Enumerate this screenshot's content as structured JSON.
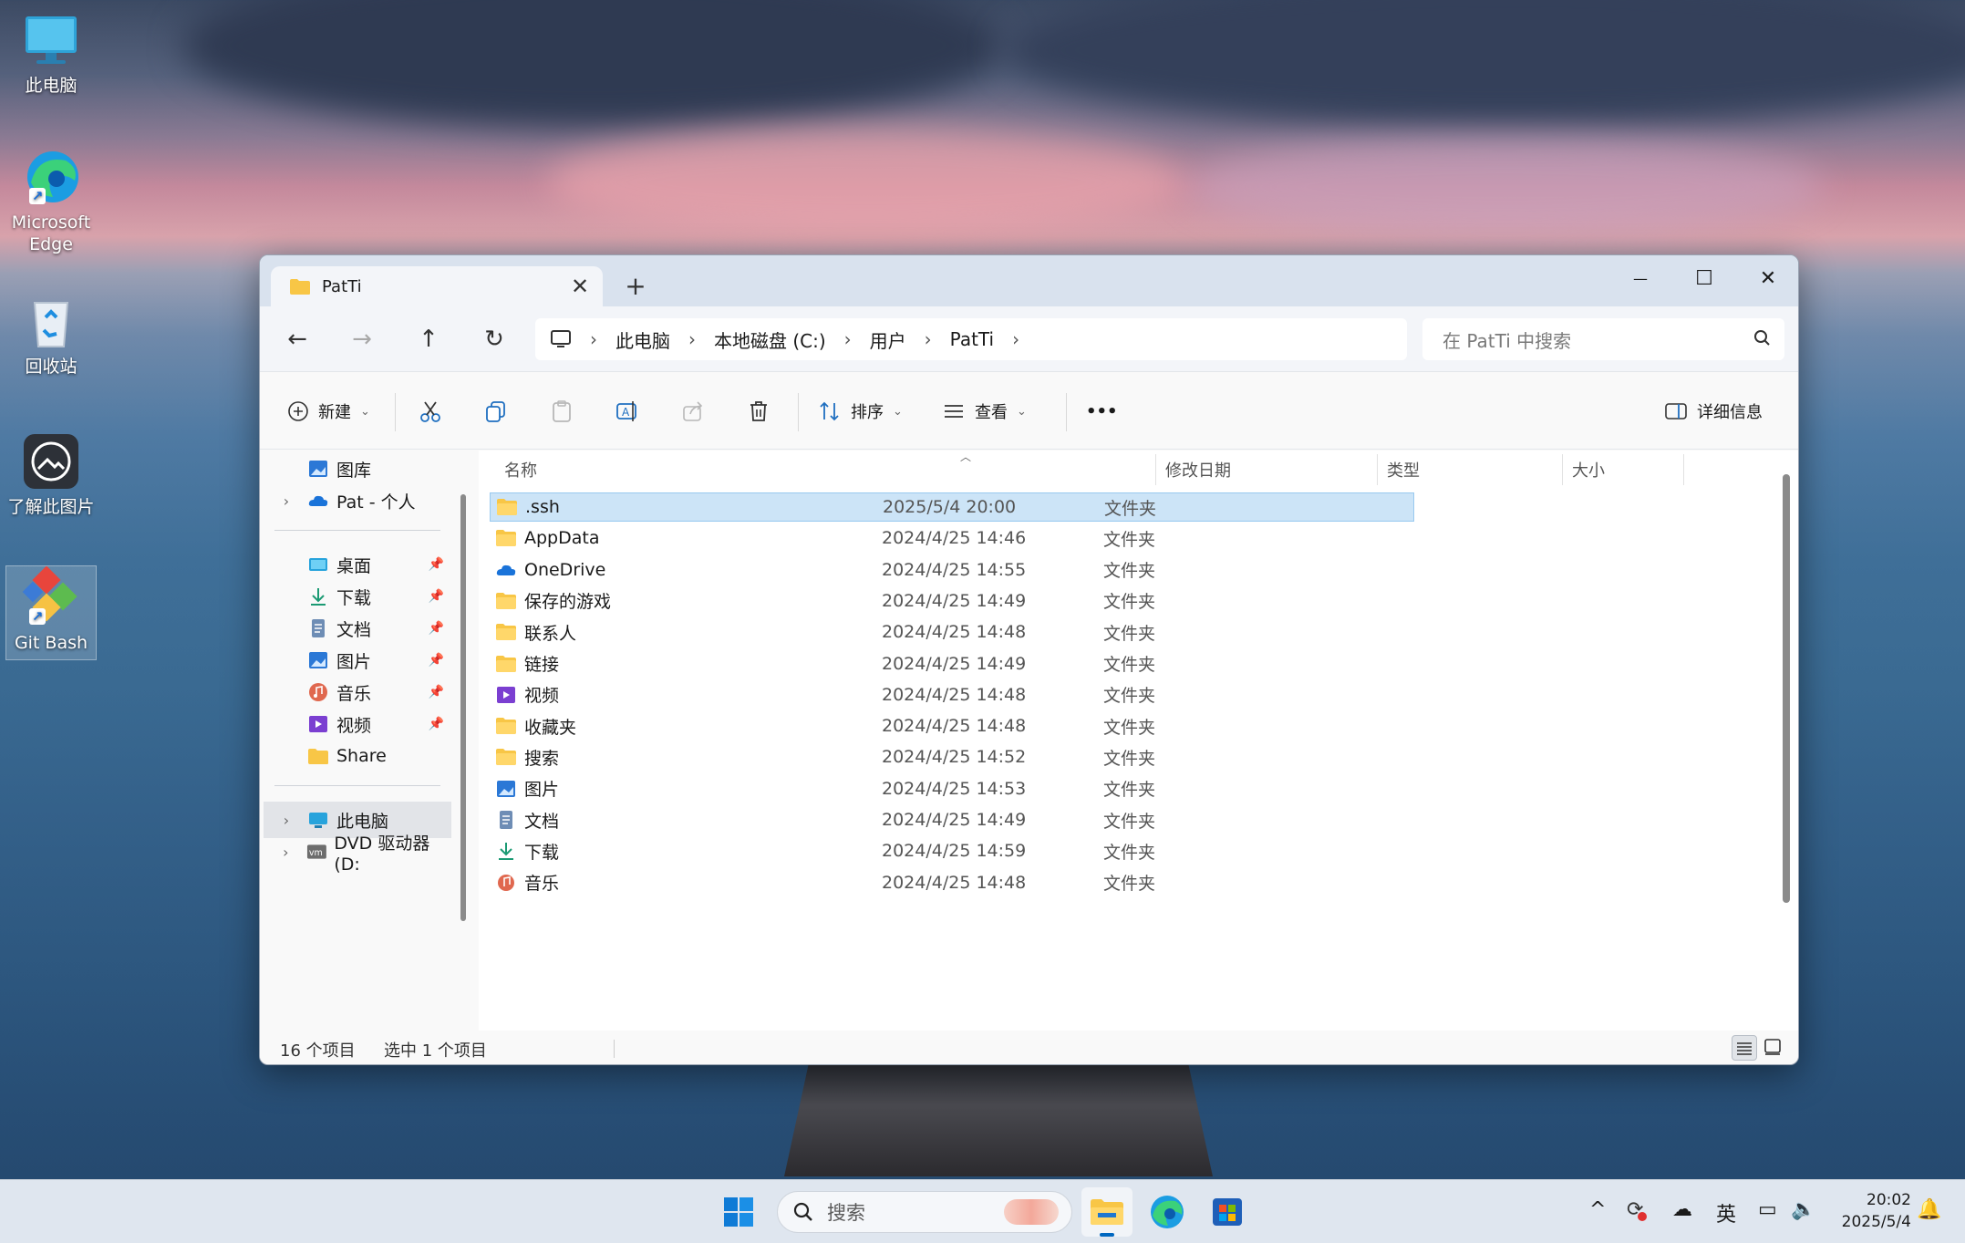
{
  "desktop": {
    "icons": [
      {
        "label": "此电脑"
      },
      {
        "label": "Microsoft Edge"
      },
      {
        "label": "回收站"
      },
      {
        "label": "了解此图片"
      },
      {
        "label": "Git Bash"
      }
    ]
  },
  "window": {
    "tab_title": "PatTi",
    "tab_close": "✕",
    "new_tab": "+",
    "controls": {
      "minimize": "—",
      "maximize": "☐",
      "close": "✕"
    }
  },
  "address": {
    "back": "←",
    "forward": "→",
    "up": "↑",
    "refresh": "↻",
    "crumbs": [
      "此电脑",
      "本地磁盘 (C:)",
      "用户",
      "PatTi"
    ],
    "separator": "›",
    "search_placeholder": "在 PatTi 中搜索"
  },
  "toolbar": {
    "new_label": "新建",
    "sort_label": "排序",
    "view_label": "查看",
    "more_label": "•••",
    "details_label": "详细信息"
  },
  "sidebar": {
    "items": [
      {
        "label": "图库",
        "icon": "gallery-icon"
      },
      {
        "label": "Pat - 个人",
        "icon": "onedrive-icon"
      },
      {
        "label": "桌面",
        "icon": "desktop-icon"
      },
      {
        "label": "下载",
        "icon": "download-icon"
      },
      {
        "label": "文档",
        "icon": "document-icon"
      },
      {
        "label": "图片",
        "icon": "pictures-icon"
      },
      {
        "label": "音乐",
        "icon": "music-icon"
      },
      {
        "label": "视频",
        "icon": "videos-icon"
      },
      {
        "label": "Share",
        "icon": "folder-icon"
      },
      {
        "label": "此电脑",
        "icon": "this-pc-icon"
      },
      {
        "label": "DVD 驱动器 (D:",
        "icon": "dvd-icon"
      }
    ],
    "pin": "📌",
    "expand": "›"
  },
  "columns": {
    "name": "名称",
    "date": "修改日期",
    "type": "类型",
    "size": "大小"
  },
  "files": [
    {
      "name": ".ssh",
      "date": "2025/5/4 20:00",
      "type": "文件夹",
      "icon": "folder-icon"
    },
    {
      "name": "AppData",
      "date": "2024/4/25 14:46",
      "type": "文件夹",
      "icon": "folder-icon"
    },
    {
      "name": "OneDrive",
      "date": "2024/4/25 14:55",
      "type": "文件夹",
      "icon": "onedrive-icon"
    },
    {
      "name": "保存的游戏",
      "date": "2024/4/25 14:49",
      "type": "文件夹",
      "icon": "folder-icon"
    },
    {
      "name": "联系人",
      "date": "2024/4/25 14:48",
      "type": "文件夹",
      "icon": "folder-icon"
    },
    {
      "name": "链接",
      "date": "2024/4/25 14:49",
      "type": "文件夹",
      "icon": "folder-icon"
    },
    {
      "name": "视频",
      "date": "2024/4/25 14:48",
      "type": "文件夹",
      "icon": "videos-icon"
    },
    {
      "name": "收藏夹",
      "date": "2024/4/25 14:48",
      "type": "文件夹",
      "icon": "folder-icon"
    },
    {
      "name": "搜索",
      "date": "2024/4/25 14:52",
      "type": "文件夹",
      "icon": "folder-icon"
    },
    {
      "name": "图片",
      "date": "2024/4/25 14:53",
      "type": "文件夹",
      "icon": "pictures-icon"
    },
    {
      "name": "文档",
      "date": "2024/4/25 14:49",
      "type": "文件夹",
      "icon": "document-icon"
    },
    {
      "name": "下载",
      "date": "2024/4/25 14:59",
      "type": "文件夹",
      "icon": "download-icon"
    },
    {
      "name": "音乐",
      "date": "2024/4/25 14:48",
      "type": "文件夹",
      "icon": "music-icon"
    }
  ],
  "status": {
    "count": "16 个项目",
    "selected": "选中 1 个项目"
  },
  "taskbar": {
    "search_placeholder": "搜索",
    "tray_chevron": "^",
    "ime": "英",
    "time": "20:02",
    "date": "2025/5/4"
  },
  "colors": {
    "accent": "#0067c0",
    "selection": "#cce4f7",
    "folder": "#f8c646"
  }
}
